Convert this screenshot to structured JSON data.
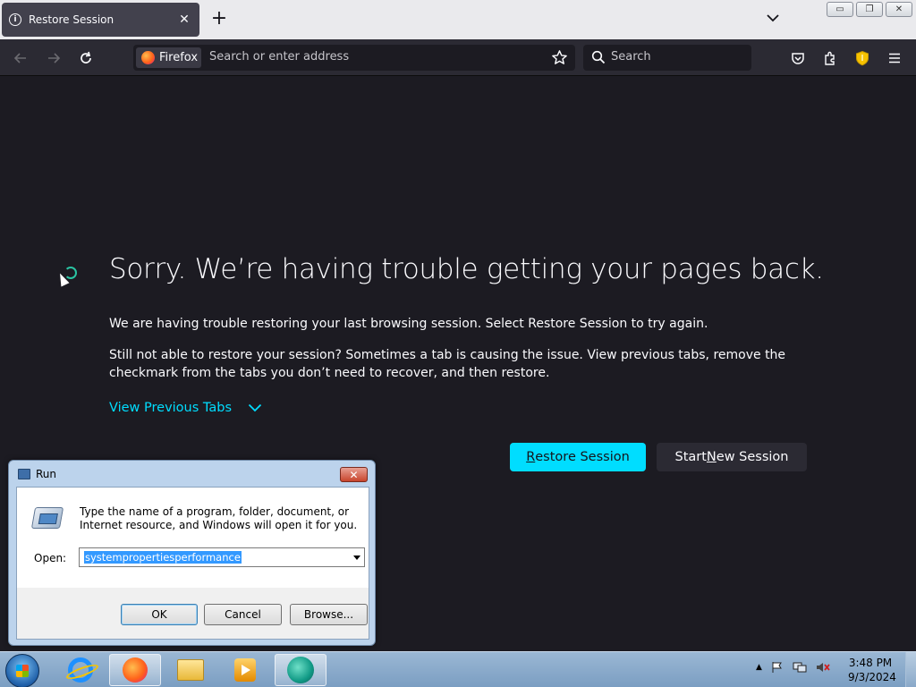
{
  "browser": {
    "tab": {
      "title": "Restore Session",
      "icon": "info-icon"
    },
    "urlbar": {
      "identity": "Firefox",
      "placeholder": "Search or enter address"
    },
    "searchbar": {
      "placeholder": "Search"
    }
  },
  "page": {
    "heading": "Sorry. We’re having trouble getting your pages back.",
    "p1": "We are having trouble restoring your last browsing session. Select Restore Session to try again.",
    "p2": "Still not able to restore your session? Sometimes a tab is causing the issue. View previous tabs, remove the checkmark from the tabs you don’t need to recover, and then restore.",
    "view_tabs": "View Previous Tabs",
    "restore_btn": {
      "pre": "",
      "u": "R",
      "post": "estore Session"
    },
    "new_btn": {
      "pre": "Start ",
      "u": "N",
      "post": "ew Session"
    },
    "accent": "#00ddff"
  },
  "run_dialog": {
    "title": "Run",
    "description": "Type the name of a program, folder, document, or Internet resource, and Windows will open it for you.",
    "open_label": "Open:",
    "open_value": "systempropertiesperformance",
    "ok": "OK",
    "cancel": "Cancel",
    "browse": "Browse..."
  },
  "taskbar": {
    "time": "3:48 PM",
    "date": "9/3/2024",
    "tray_arrow": "▲",
    "apps": [
      "internet-explorer-icon",
      "firefox-icon",
      "file-explorer-icon",
      "media-player-icon",
      "app-icon"
    ]
  }
}
